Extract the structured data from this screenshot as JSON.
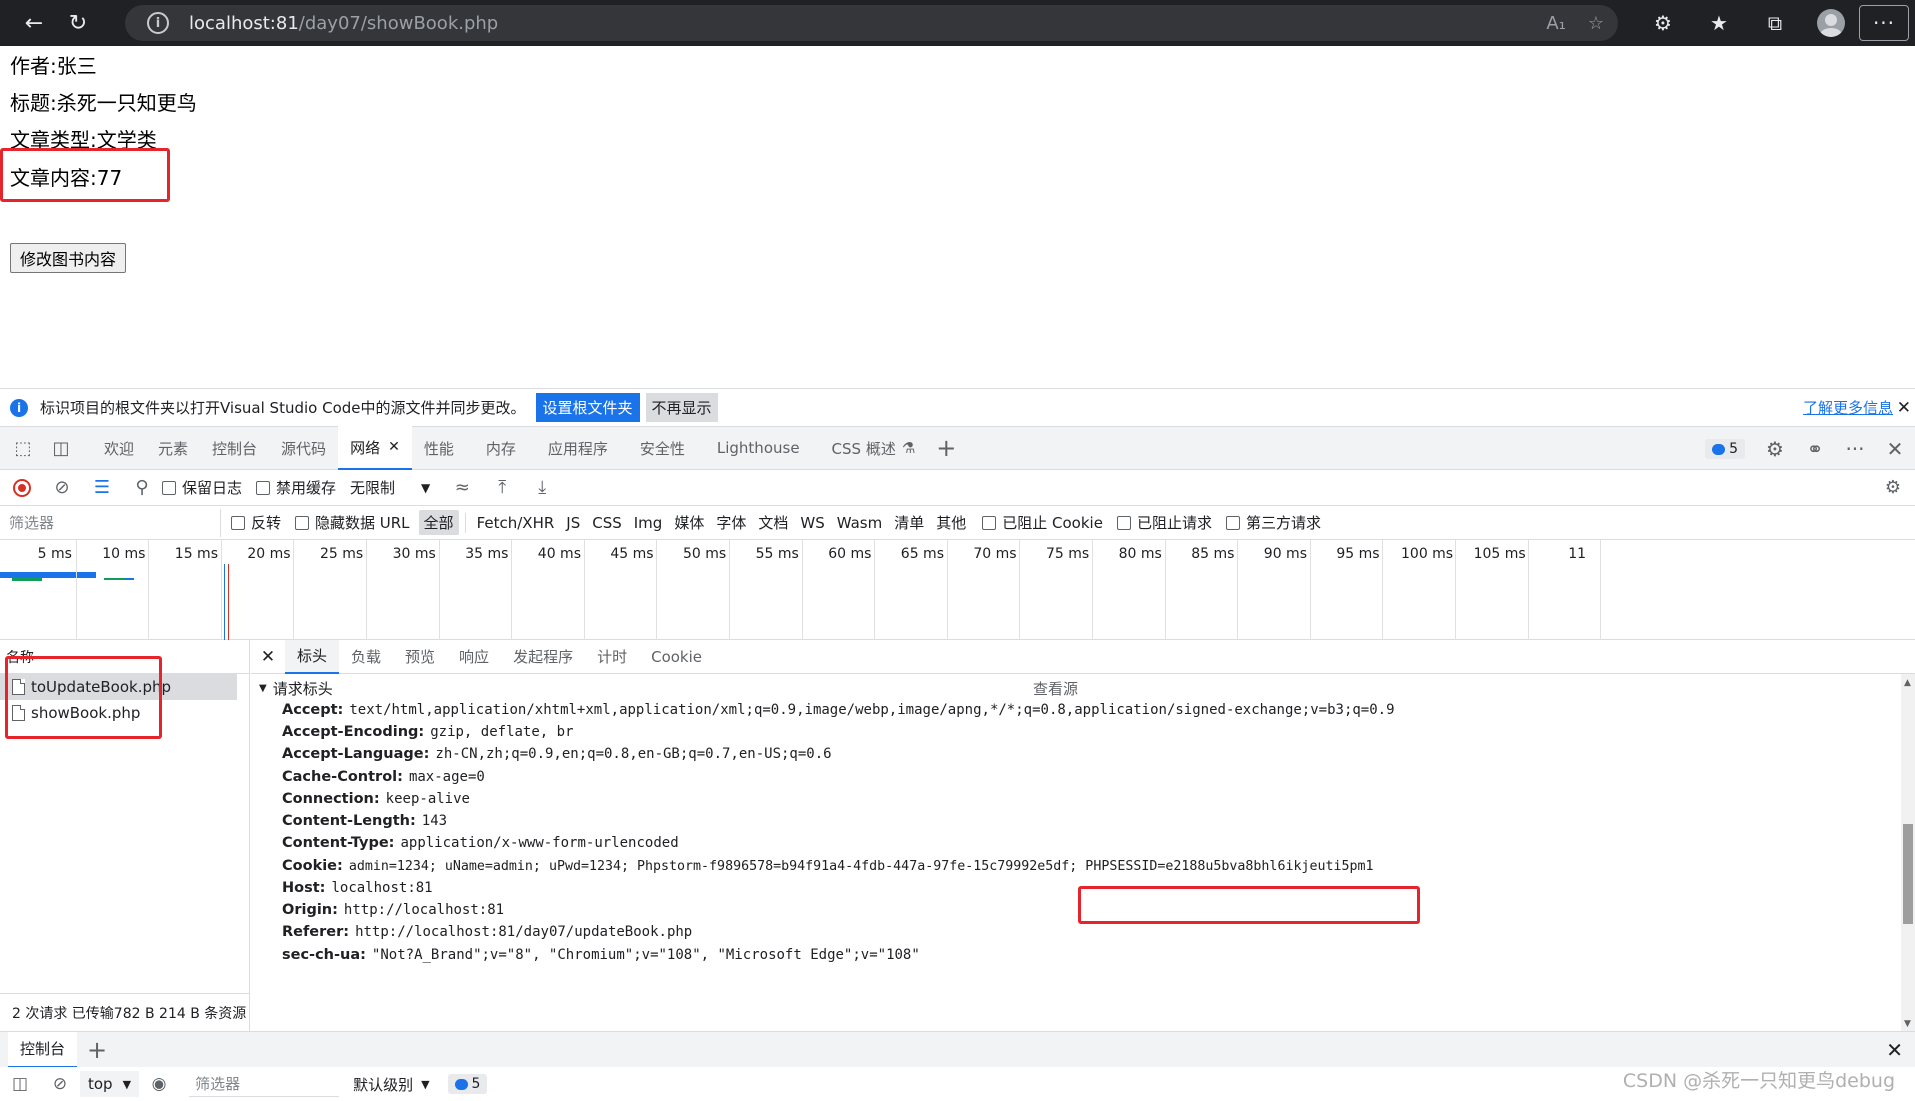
{
  "browser": {
    "url_host": "localhost:81",
    "url_path": "/day07/showBook.php"
  },
  "page": {
    "author": "作者:张三",
    "title": "标题:杀死一只知更鸟",
    "type": "文章类型:文学类",
    "content": "文章内容:77",
    "edit_button": "修改图书内容"
  },
  "infobar": {
    "message": "标识项目的根文件夹以打开Visual Studio Code中的源文件并同步更改。",
    "set_root": "设置根文件夹",
    "dont_show": "不再显示",
    "learn_more": "了解更多信息"
  },
  "devtools": {
    "tabs": [
      "欢迎",
      "元素",
      "控制台",
      "源代码",
      "网络",
      "性能",
      "内存",
      "应用程序",
      "安全性",
      "Lighthouse",
      "CSS 概述"
    ],
    "active_tab": "网络",
    "issues_count": "5"
  },
  "network_toolbar": {
    "preserve_log": "保留日志",
    "disable_cache": "禁用缓存",
    "throttle": "无限制"
  },
  "filter_row": {
    "placeholder": "筛选器",
    "invert": "反转",
    "hide_data_urls": "隐藏数据 URL",
    "types": [
      "全部",
      "Fetch/XHR",
      "JS",
      "CSS",
      "Img",
      "媒体",
      "字体",
      "文档",
      "WS",
      "Wasm",
      "清单",
      "其他"
    ],
    "blocked_cookies": "已阻止 Cookie",
    "blocked_requests": "已阻止请求",
    "third_party": "第三方请求"
  },
  "timeline": {
    "ticks": [
      "5 ms",
      "10 ms",
      "15 ms",
      "20 ms",
      "25 ms",
      "30 ms",
      "35 ms",
      "40 ms",
      "45 ms",
      "50 ms",
      "55 ms",
      "60 ms",
      "65 ms",
      "70 ms",
      "75 ms",
      "80 ms",
      "85 ms",
      "90 ms",
      "95 ms",
      "100 ms",
      "105 ms",
      "11"
    ]
  },
  "requests": {
    "header": "名称",
    "items": [
      "toUpdateBook.php",
      "showBook.php"
    ],
    "footer": "2 次请求  已传输782 B  214 B 条资源"
  },
  "detail": {
    "tabs": [
      "标头",
      "负载",
      "预览",
      "响应",
      "发起程序",
      "计时",
      "Cookie"
    ],
    "section": "请求标头",
    "view_source": "查看源",
    "headers": [
      {
        "k": "Accept:",
        "v": "text/html,application/xhtml+xml,application/xml;q=0.9,image/webp,image/apng,*/*;q=0.8,application/signed-exchange;v=b3;q=0.9"
      },
      {
        "k": "Accept-Encoding:",
        "v": "gzip, deflate, br"
      },
      {
        "k": "Accept-Language:",
        "v": "zh-CN,zh;q=0.9,en;q=0.8,en-GB;q=0.7,en-US;q=0.6"
      },
      {
        "k": "Cache-Control:",
        "v": "max-age=0"
      },
      {
        "k": "Connection:",
        "v": "keep-alive"
      },
      {
        "k": "Content-Length:",
        "v": "143"
      },
      {
        "k": "Content-Type:",
        "v": "application/x-www-form-urlencoded"
      },
      {
        "k": "Cookie:",
        "v": "admin=1234; uName=admin; uPwd=1234; Phpstorm-f9896578=b94f91a4-4fdb-447a-97fe-15c79992e5df; PHPSESSID=e2188u5bva8bhl6ikjeuti5pm1"
      },
      {
        "k": "Host:",
        "v": "localhost:81"
      },
      {
        "k": "Origin:",
        "v": "http://localhost:81"
      },
      {
        "k": "Referer:",
        "v": "http://localhost:81/day07/updateBook.php"
      },
      {
        "k": "sec-ch-ua:",
        "v": "\"Not?A_Brand\";v=\"8\", \"Chromium\";v=\"108\", \"Microsoft Edge\";v=\"108\""
      }
    ]
  },
  "console": {
    "tab": "控制台",
    "context": "top",
    "filter_placeholder": "筛选器",
    "level": "默认级别",
    "issues": "5"
  },
  "watermark": "CSDN @杀死一只知更鸟debug"
}
